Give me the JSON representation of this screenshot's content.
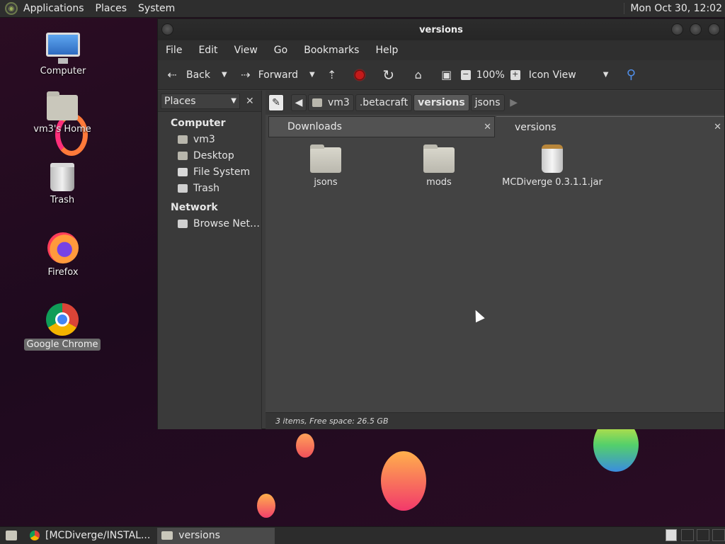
{
  "top_panel": {
    "menus": [
      "Applications",
      "Places",
      "System"
    ],
    "clock": "Mon Oct 30, 12:02"
  },
  "desktop": {
    "icons": [
      {
        "label": "Computer",
        "icon": "computer-icon"
      },
      {
        "label": "vm3's Home",
        "icon": "home-folder-icon"
      },
      {
        "label": "Trash",
        "icon": "trash-icon"
      },
      {
        "label": "Firefox",
        "icon": "firefox-icon"
      },
      {
        "label": "Google Chrome",
        "icon": "chrome-icon",
        "selected": true
      }
    ]
  },
  "window": {
    "title": "versions",
    "menu": [
      "File",
      "Edit",
      "View",
      "Go",
      "Bookmarks",
      "Help"
    ],
    "toolbar": {
      "back": "Back",
      "forward": "Forward",
      "zoom": "100%",
      "view_mode": "Icon View"
    },
    "sidebar": {
      "selector": "Places",
      "sections": [
        {
          "title": "Computer",
          "items": [
            "vm3",
            "Desktop",
            "File System",
            "Trash"
          ]
        },
        {
          "title": "Network",
          "items": [
            "Browse Net…"
          ]
        }
      ]
    },
    "path": [
      "vm3",
      ".betacraft",
      "versions",
      "jsons"
    ],
    "active_path": "versions",
    "tabs": [
      {
        "label": "Downloads",
        "active": false
      },
      {
        "label": "versions",
        "active": true
      }
    ],
    "files": [
      {
        "name": "jsons",
        "type": "folder"
      },
      {
        "name": "mods",
        "type": "folder"
      },
      {
        "name": "MCDiverge 0.3.1.1.jar",
        "type": "jar"
      }
    ],
    "status": "3 items, Free space: 26.5 GB"
  },
  "taskbar": {
    "tasks": [
      {
        "label": "[MCDiverge/INSTAL...",
        "icon": "chrome-icon",
        "active": false
      },
      {
        "label": "versions",
        "icon": "folder-icon",
        "active": true
      }
    ]
  }
}
